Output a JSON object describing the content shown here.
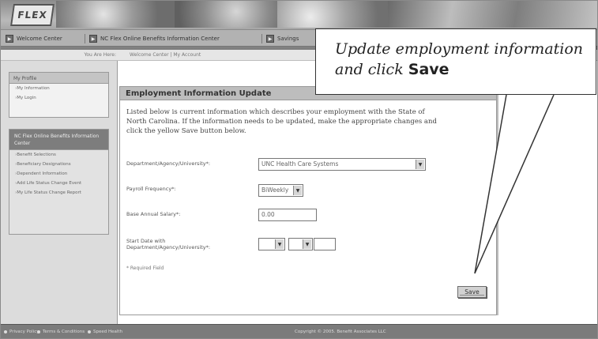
{
  "banner": {
    "logo_text": "FLEX",
    "nav": [
      {
        "label": "Welcome Center"
      },
      {
        "label": "NC Flex Online Benefits Information Center"
      },
      {
        "label": "Savings"
      }
    ]
  },
  "breadcrumb": {
    "prefix": "You Are Here:",
    "path": "Welcome Center | My Account"
  },
  "sidebar": {
    "profile_title": "My Profile",
    "profile_links": [
      {
        "label": "My Information"
      },
      {
        "label": "My Login"
      }
    ],
    "center_title": "NC Flex Online Benefits Information Center",
    "center_links": [
      {
        "label": "Benefit Selections"
      },
      {
        "label": "Beneficiary Designations"
      },
      {
        "label": "Dependent Information"
      },
      {
        "label": "Add Life Status Change Event"
      },
      {
        "label": "My Life Status Change Report"
      }
    ]
  },
  "main": {
    "title": "Employment Information Update",
    "intro": "Listed below is current information which describes your employment with the State of North Carolina. If the information needs to be updated, make the appropriate changes and click the yellow Save button below.",
    "fields": {
      "department": {
        "label": "Department/Agency/University*:",
        "value": "UNC Health Care Systems"
      },
      "payroll": {
        "label": "Payroll Frequency*:",
        "value": "BiWeekly"
      },
      "salary": {
        "label": "Base Annual Salary*:",
        "value": "0.00"
      },
      "start_date": {
        "label": "Start Date with Department/Agency/University*:",
        "month": "",
        "day": "",
        "year": ""
      }
    },
    "required_note": "* Required Field",
    "save_label": "Save"
  },
  "footer": {
    "links": [
      {
        "label": "Privacy Policy"
      },
      {
        "label": "Terms & Conditions"
      },
      {
        "label": "Speed Health"
      }
    ],
    "copyright": "Copyright © 2005. Benefit Associates LLC"
  },
  "callout": {
    "text_part1": "Update employment information and click ",
    "text_bold": "Save"
  },
  "colors": {
    "banner": "#8d8d8d",
    "sidebar": "#dcdcdc",
    "panel_header": "#bdbdbd",
    "footer": "#7b7b7b"
  }
}
